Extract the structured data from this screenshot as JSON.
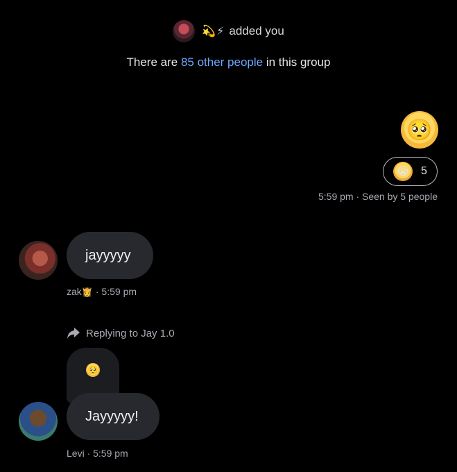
{
  "system": {
    "added_emoji_name": "💫⚡",
    "added_text": "added you",
    "info_prefix": "There are",
    "info_link": "85 other people",
    "info_suffix": "in this group"
  },
  "outgoing": {
    "emoji": "🥺",
    "reaction_emoji": "😭",
    "reaction_count": "5",
    "time_seen": "5:59 pm · Seen by 5 people"
  },
  "messages": [
    {
      "sender": "zak",
      "sender_emoji": "👸",
      "text": "jayyyyy",
      "time": "· 5:59 pm"
    },
    {
      "reply_label": "Replying to Jay 1.0",
      "quoted_emoji": "🥺",
      "sender": "Levi",
      "text": "Jayyyyy!",
      "time": "· 5:59 pm"
    }
  ],
  "colors": {
    "background": "#000000",
    "bubble": "#27292e",
    "link": "#6fa7ff",
    "meta_text": "#a8abb2"
  }
}
